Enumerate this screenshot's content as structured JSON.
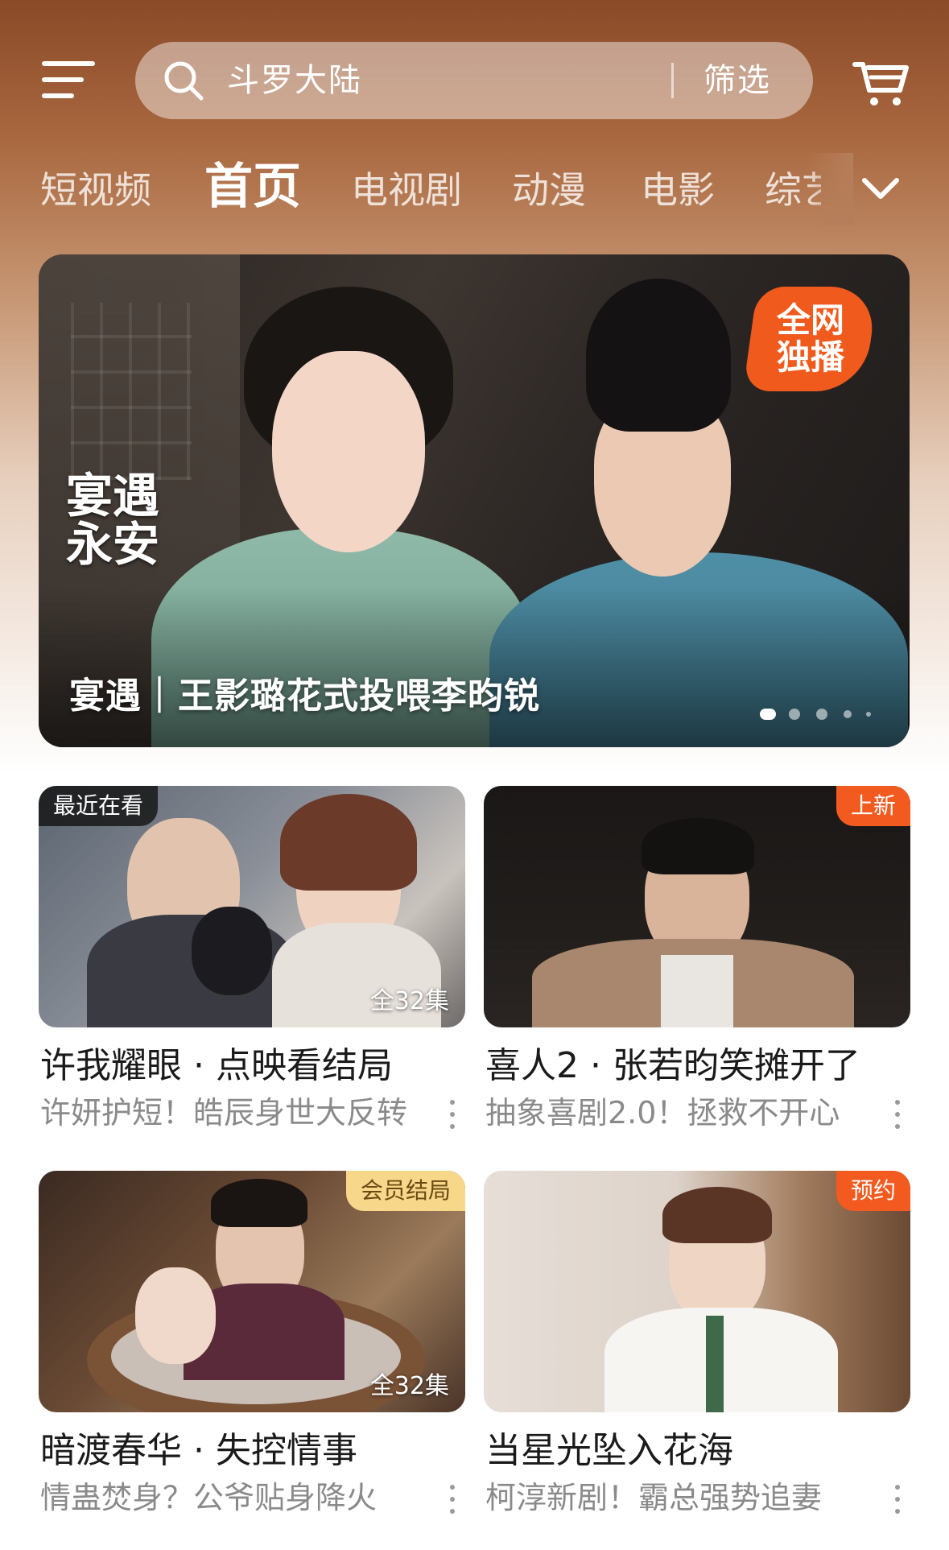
{
  "header": {
    "search_placeholder": "斗罗大陆",
    "filter_label": "筛选"
  },
  "tabs": [
    {
      "label": "短视频"
    },
    {
      "label": "首页"
    },
    {
      "label": "电视剧"
    },
    {
      "label": "动漫"
    },
    {
      "label": "电影"
    },
    {
      "label": "综艺"
    }
  ],
  "banner": {
    "title_art": "宴遇永安",
    "badge": "全网独播",
    "caption": "宴遇｜王影璐花式投喂李昀锐"
  },
  "cards": [
    {
      "tag": "最近在看",
      "episodes": "全32集",
      "title": "许我耀眼 · 点映看结局",
      "subtitle": "许妍护短！皓辰身世大反转"
    },
    {
      "tag": "上新",
      "episodes": "",
      "title": "喜人2 · 张若昀笑摊开了",
      "subtitle": "抽象喜剧2.0！拯救不开心"
    },
    {
      "tag": "会员结局",
      "episodes": "全32集",
      "title": "暗渡春华 · 失控情事",
      "subtitle": "情蛊焚身？公爷贴身降火"
    },
    {
      "tag": "预约",
      "episodes": "",
      "title": "当星光坠入花海",
      "subtitle": "柯淳新剧！霸总强势追妻"
    }
  ],
  "colors": {
    "accent_orange": "#f35a1f",
    "vip_gold": "#f7d78a",
    "header_brown": "#a9683f"
  }
}
